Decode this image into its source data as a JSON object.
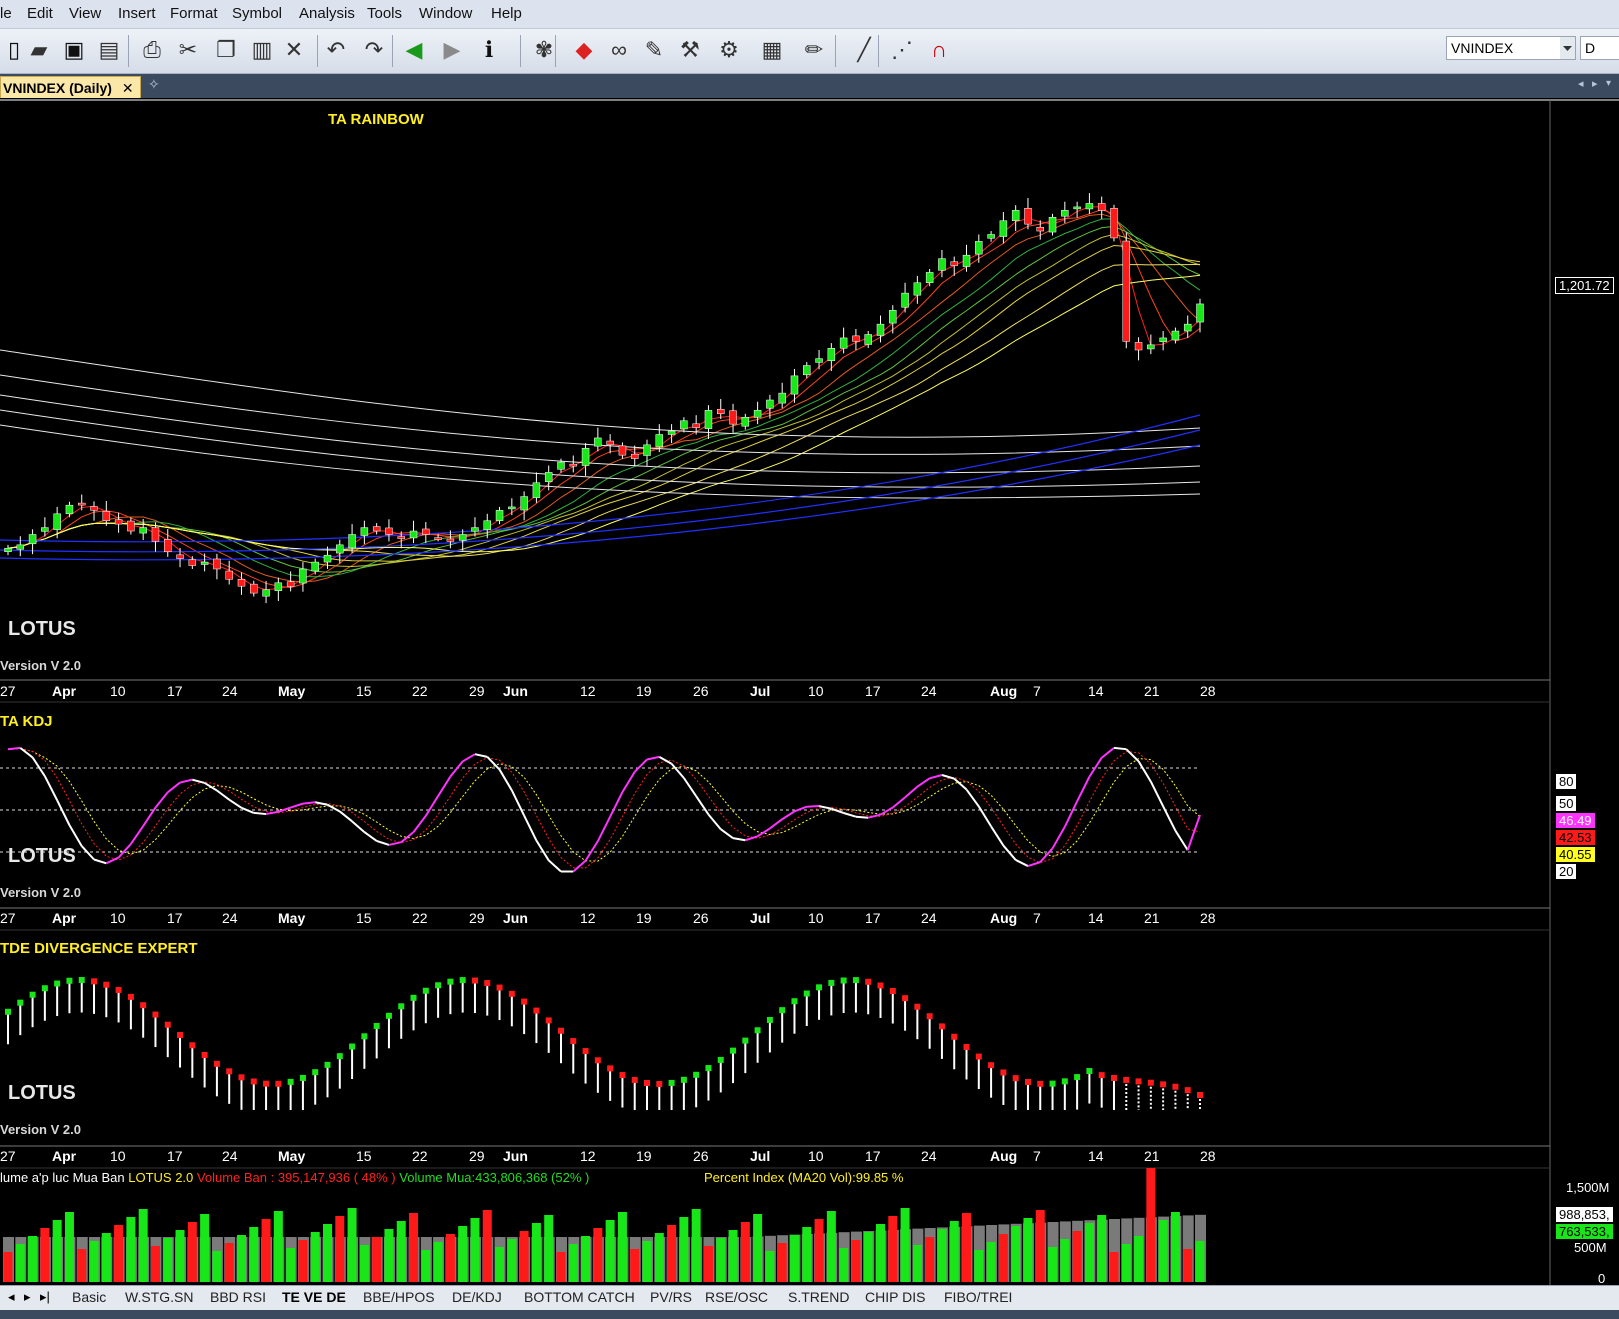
{
  "menu": [
    "le",
    "Edit",
    "View",
    "Insert",
    "Format",
    "Symbol",
    "Analysis",
    "Tools",
    "Window",
    "Help"
  ],
  "toolbar": {
    "icons": [
      "new-icon",
      "open-folder-icon",
      "save-icon",
      "save-all-icon",
      "print-icon",
      "cut-icon",
      "copy-icon",
      "paste-icon",
      "delete-icon",
      "undo-icon",
      "redo-icon",
      "back-icon",
      "forward-icon",
      "info-icon",
      "indicator-icon",
      "diamond-icon",
      "binoculars-icon",
      "notes-icon",
      "explorer-icon",
      "tools-icon",
      "chart-icon",
      "draw-pen-icon",
      "line-icon",
      "dotted-line-icon",
      "magnet-icon"
    ],
    "symbol": "VNINDEX",
    "period": "D"
  },
  "document_tab": "VNINDEX (Daily)",
  "colors": {
    "up": "#19e619",
    "down": "#ff1a1a",
    "title": "#ffee22",
    "kdj_k": "#ff33ff",
    "kdj_d": "#ff2222",
    "kdj_j": "#ffff33"
  },
  "panes": {
    "price": {
      "title": "TA RAINBOW",
      "watermark": "LOTUS",
      "version": "Version V 2.0",
      "last_price": "1,201.72"
    },
    "kdj": {
      "title": "TA KDJ",
      "watermark": "LOTUS",
      "version": "Version V 2.0",
      "levels": [
        "80",
        "50",
        "20"
      ],
      "k_val": "46.49",
      "d_val": "42.53",
      "j_val": "40.55"
    },
    "div": {
      "title": "TDE DIVERGENCE EXPERT",
      "watermark": "LOTUS",
      "version": "Version V 2.0"
    },
    "volume": {
      "label_a": "lume a'p luc Mua Ban",
      "label_b": "LOTUS 2.0",
      "label_c": "Volume Ban : 395,147,936 ( 48% )",
      "label_d": "Volume Mua:433,806,368 (52% )",
      "label_e": "Percent Index (MA20 Vol):99.85 %",
      "scale": [
        "1,500M",
        "500M",
        "0"
      ],
      "val_total": "988,853,",
      "val_buy": "763,533,"
    }
  },
  "x_axis": [
    "27",
    "Apr",
    "10",
    "17",
    "24",
    "May",
    "15",
    "22",
    "29",
    "Jun",
    "12",
    "19",
    "26",
    "Jul",
    "10",
    "17",
    "24",
    "Aug",
    "7",
    "14",
    "21",
    "28"
  ],
  "sheets": [
    "Basic",
    "W.STG.SN",
    "BBD RSI",
    "TE VE DE",
    "BBE/HPOS",
    "DE/KDJ",
    "BOTTOM CATCH",
    "PV/RS",
    "RSE/OSC",
    "S.TREND",
    "CHIP DIS",
    "FIBO/TREI"
  ],
  "active_sheet": "TE VE DE",
  "chart_data": {
    "type": "candlestick",
    "title": "TA RAINBOW",
    "close": [
      1060,
      1062,
      1068,
      1072,
      1080,
      1085,
      1086,
      1082,
      1076,
      1074,
      1070,
      1072,
      1064,
      1058,
      1054,
      1050,
      1052,
      1048,
      1042,
      1038,
      1034,
      1036,
      1040,
      1038,
      1048,
      1052,
      1056,
      1062,
      1068,
      1072,
      1070,
      1068,
      1066,
      1070,
      1068,
      1066,
      1064,
      1068,
      1072,
      1076,
      1082,
      1084,
      1090,
      1098,
      1104,
      1110,
      1108,
      1118,
      1124,
      1120,
      1114,
      1112,
      1120,
      1126,
      1128,
      1134,
      1130,
      1140,
      1138,
      1132,
      1136,
      1140,
      1146,
      1150,
      1160,
      1166,
      1170,
      1176,
      1182,
      1180,
      1184,
      1190,
      1198,
      1208,
      1214,
      1220,
      1228,
      1224,
      1230,
      1238,
      1242,
      1250,
      1256,
      1248,
      1244,
      1252,
      1256,
      1258,
      1260,
      1256,
      1240,
      1180,
      1175,
      1178,
      1182,
      1186,
      1190,
      1201.72
    ],
    "ylim": [
      1030,
      1262
    ]
  }
}
